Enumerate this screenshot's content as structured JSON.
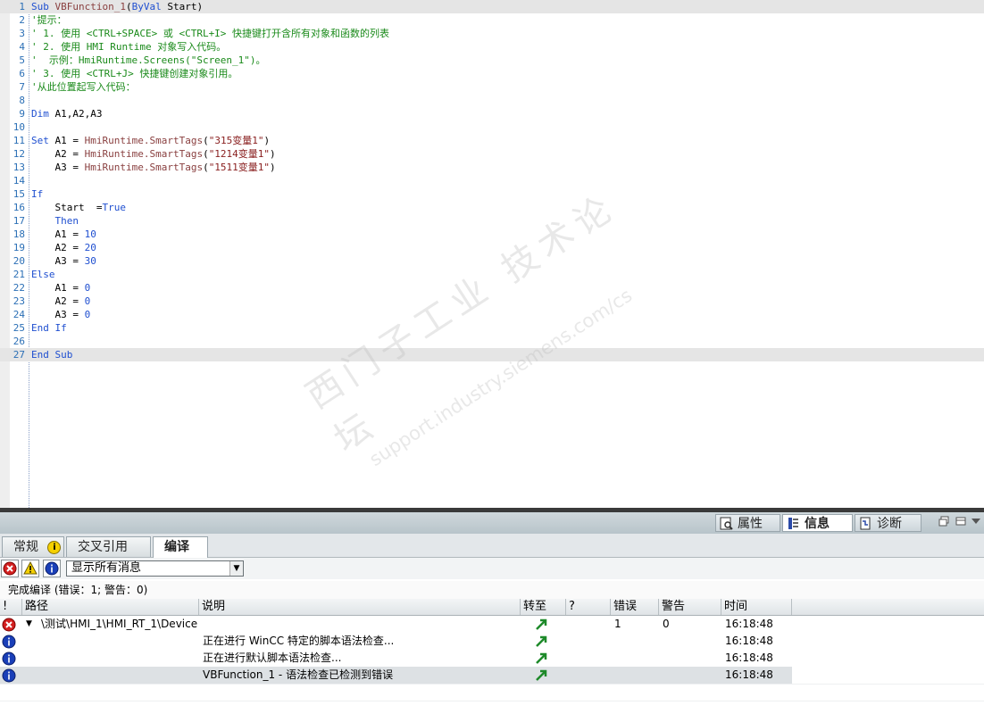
{
  "editor": {
    "lines": [
      {
        "n": "1",
        "html": "<span class=\"kw\">Sub</span> <span class=\"fn\">VBFunction_1</span>(<span class=\"kw\">ByVal</span> Start)",
        "hl": true
      },
      {
        "n": "2",
        "html": "<span class=\"cm\">'提示：</span>"
      },
      {
        "n": "3",
        "html": "<span class=\"cm\">' 1. 使用 &lt;CTRL+SPACE&gt; 或 &lt;CTRL+I&gt; 快捷键打开含所有对象和函数的列表</span>"
      },
      {
        "n": "4",
        "html": "<span class=\"cm\">' 2. 使用 HMI Runtime 对象写入代码。</span>"
      },
      {
        "n": "5",
        "html": "<span class=\"cm\">'  示例：HmiRuntime.Screens(\"Screen_1\")。</span>"
      },
      {
        "n": "6",
        "html": "<span class=\"cm\">' 3. 使用 &lt;CTRL+J&gt; 快捷键创建对象引用。</span>"
      },
      {
        "n": "7",
        "html": "<span class=\"cm\">'从此位置起写入代码：</span>"
      },
      {
        "n": "8",
        "html": ""
      },
      {
        "n": "9",
        "html": "<span class=\"kw\">Dim</span> A1,A2,A3"
      },
      {
        "n": "10",
        "html": ""
      },
      {
        "n": "11",
        "html": "<span class=\"kw\">Set</span> A1 = <span class=\"fn\">HmiRuntime.SmartTags</span>(<span class=\"str\">\"315变量1\"</span>)"
      },
      {
        "n": "12",
        "html": "    A2 = <span class=\"fn\">HmiRuntime.SmartTags</span>(<span class=\"str\">\"1214变量1\"</span>)"
      },
      {
        "n": "13",
        "html": "    A3 = <span class=\"fn\">HmiRuntime.SmartTags</span>(<span class=\"str\">\"1511变量1\"</span>)"
      },
      {
        "n": "14",
        "html": ""
      },
      {
        "n": "15",
        "html": "<span class=\"kw\">If</span>"
      },
      {
        "n": "16",
        "html": "    Start  =<span class=\"kw\">True</span>"
      },
      {
        "n": "17",
        "html": "    <span class=\"kw\">Then</span>"
      },
      {
        "n": "18",
        "html": "    A1 = <span class=\"num\">10</span>"
      },
      {
        "n": "19",
        "html": "    A2 = <span class=\"num\">20</span>"
      },
      {
        "n": "20",
        "html": "    A3 = <span class=\"num\">30</span>"
      },
      {
        "n": "21",
        "html": "<span class=\"kw\">Else</span>"
      },
      {
        "n": "22",
        "html": "    A1 = <span class=\"num\">0</span>"
      },
      {
        "n": "23",
        "html": "    A2 = <span class=\"num\">0</span>"
      },
      {
        "n": "24",
        "html": "    A3 = <span class=\"num\">0</span>"
      },
      {
        "n": "25",
        "html": "<span class=\"kw\">End</span> <span class=\"kw\">If</span>"
      },
      {
        "n": "26",
        "html": ""
      },
      {
        "n": "27",
        "html": "<span class=\"kw\">End</span> <span class=\"kw\">Sub</span>",
        "hl": true
      }
    ]
  },
  "watermark": {
    "line1": "西门子工业 技术论坛",
    "line2": "support.industry.siemens.com/cs"
  },
  "inspector": {
    "tabs": [
      {
        "label": "属性",
        "icon": "properties-icon"
      },
      {
        "label": "信息",
        "icon": "info-tab-icon",
        "active": true,
        "warn": "i"
      },
      {
        "label": "诊断",
        "icon": "diagnostics-icon"
      }
    ]
  },
  "subtabs": [
    {
      "label": "常规",
      "warn": "i"
    },
    {
      "label": "交叉引用"
    },
    {
      "label": "编译",
      "active": true
    }
  ],
  "filter": {
    "selected": "显示所有消息"
  },
  "status": "完成编译 (错误：1; 警告：0)",
  "table": {
    "headers": [
      "!",
      "路径",
      "说明",
      "转至",
      "?",
      "错误",
      "警告",
      "时间"
    ],
    "rows": [
      {
        "type": "error",
        "path": "\\测试\\HMI_1\\HMI_RT_1\\Device\\...",
        "desc": "",
        "errors": "1",
        "warnings": "0",
        "time": "16:18:48",
        "expand": true
      },
      {
        "type": "info",
        "path": "",
        "desc": "正在进行 WinCC 特定的脚本语法检查...",
        "errors": "",
        "warnings": "",
        "time": "16:18:48"
      },
      {
        "type": "info",
        "path": "",
        "desc": "正在进行默认脚本语法检查...",
        "errors": "",
        "warnings": "",
        "time": "16:18:48"
      },
      {
        "type": "info",
        "path": "",
        "desc": "VBFunction_1 - 语法检查已检测到错误",
        "errors": "",
        "warnings": "",
        "time": "16:18:48",
        "selected": true
      }
    ]
  }
}
